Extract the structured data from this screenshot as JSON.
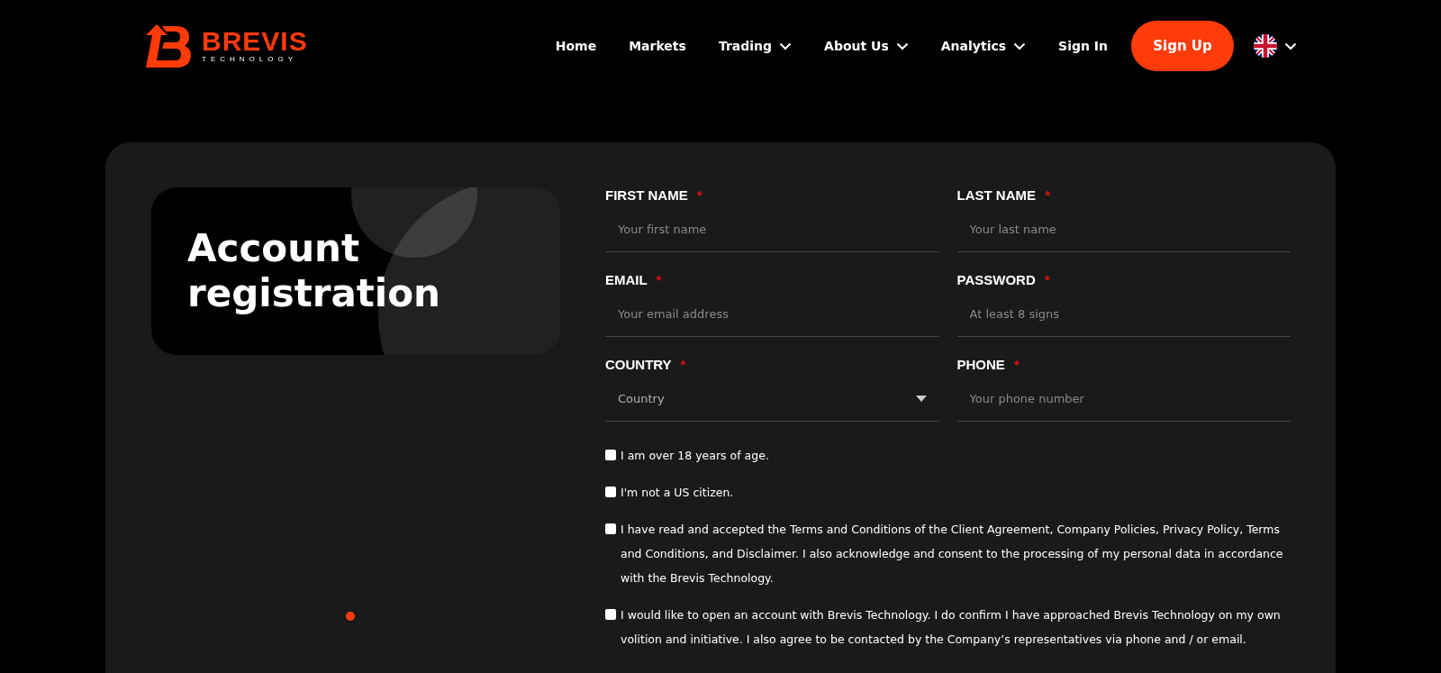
{
  "brand": {
    "name": "BREVIS",
    "tagline": "TECHNOLOGY"
  },
  "nav": [
    {
      "label": "Home",
      "dropdown": false
    },
    {
      "label": "Markets",
      "dropdown": false
    },
    {
      "label": "Trading",
      "dropdown": true
    },
    {
      "label": "About Us",
      "dropdown": true
    },
    {
      "label": "Analytics",
      "dropdown": true
    },
    {
      "label": "Sign In",
      "dropdown": false
    }
  ],
  "signup_button": "Sign Up",
  "hero": {
    "title": "Account registration"
  },
  "fields": [
    {
      "label": "FIRST NAME",
      "required": "*",
      "placeholder": "Your first name",
      "kind": "text"
    },
    {
      "label": "LAST NAME",
      "required": "*",
      "placeholder": "Your last name",
      "kind": "text"
    },
    {
      "label": "EMAIL",
      "required": "*",
      "placeholder": "Your email address",
      "kind": "text"
    },
    {
      "label": "PASSWORD",
      "required": "*",
      "placeholder": "At least 8 signs",
      "kind": "text"
    },
    {
      "label": "COUNTRY",
      "required": "*",
      "placeholder": "Country",
      "kind": "select"
    },
    {
      "label": "PHONE",
      "required": "*",
      "placeholder": "Your phone number",
      "kind": "text"
    }
  ],
  "consents": [
    {
      "text": "I am over 18 years of age.",
      "checked": false
    },
    {
      "text": "I'm not a US citizen.",
      "checked": false
    },
    {
      "text": "I have read and accepted the Terms and Conditions of the Client Agreement, Company Policies, Privacy Policy, Terms and Conditions, and Disclaimer. I also acknowledge and consent to the processing of my personal data in accordance with the Brevis Technology.",
      "checked": false
    },
    {
      "text": "I would like to open an account with Brevis Technology. I do confirm I have approached Brevis Technology on my own volition and initiative. I also agree to be contacted by the Company’s representatives via phone and / or email.",
      "checked": false
    }
  ]
}
